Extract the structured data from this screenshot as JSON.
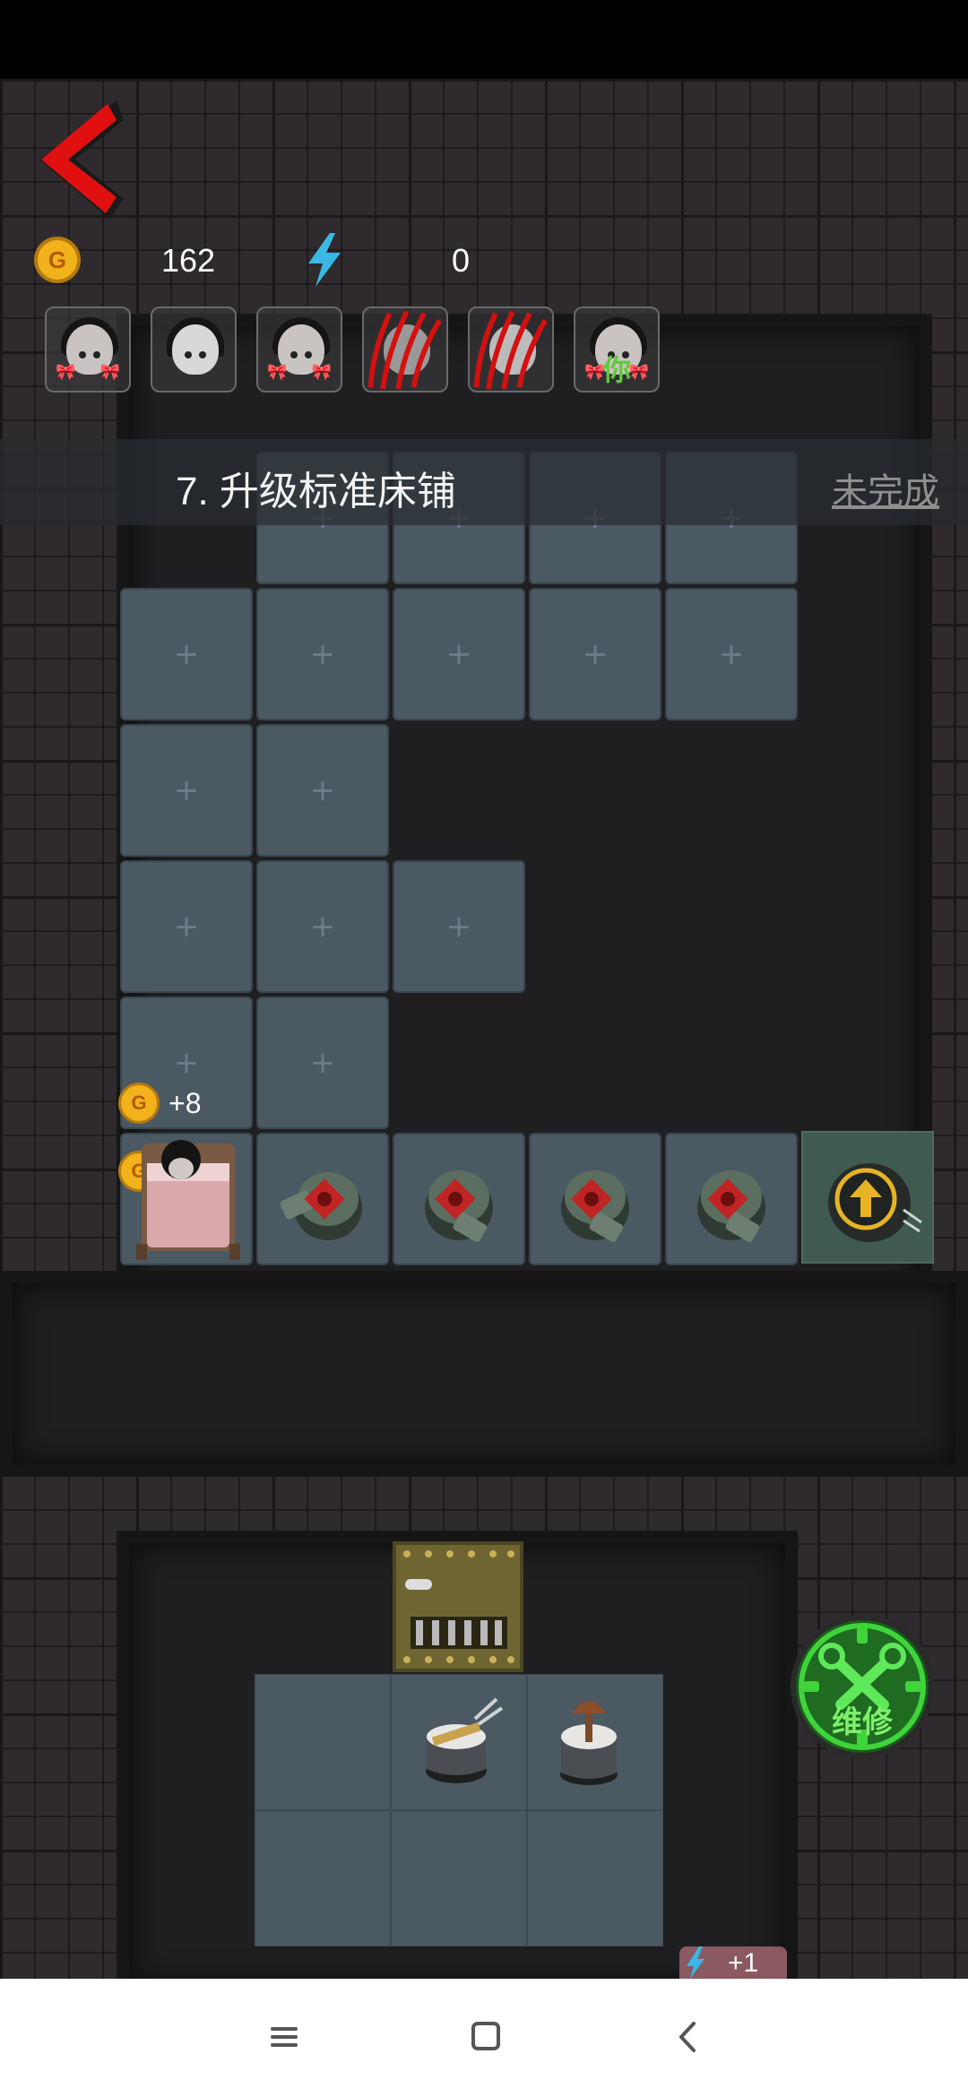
{
  "hud": {
    "gold": "162",
    "energy": "0",
    "coin_letter": "G"
  },
  "players": [
    {
      "type": "girl",
      "label": ""
    },
    {
      "type": "ghost",
      "label": ""
    },
    {
      "type": "girl",
      "label": ""
    },
    {
      "type": "clawed",
      "label": ""
    },
    {
      "type": "clawed",
      "label": ""
    },
    {
      "type": "girl-you",
      "label": "你"
    }
  ],
  "task": {
    "title": "7. 升级标准床铺",
    "status": "未完成"
  },
  "rewards": [
    {
      "value": "+8"
    },
    {
      "value": "+8"
    }
  ],
  "partial_reward": "+1",
  "repair_button": {
    "label": "维修"
  },
  "colors": {
    "back_arrow": "#e01010",
    "gold_coin": "#f2b21c",
    "energy_bolt": "#39b8e6",
    "repair_green": "#3fd43a",
    "you_label": "#5fc93a"
  },
  "icons": {
    "back": "back-arrow-icon",
    "gold": "gold-coin-icon",
    "energy": "lightning-icon",
    "upgrade": "arrow-up-circle-icon",
    "repair": "wrench-icon"
  }
}
